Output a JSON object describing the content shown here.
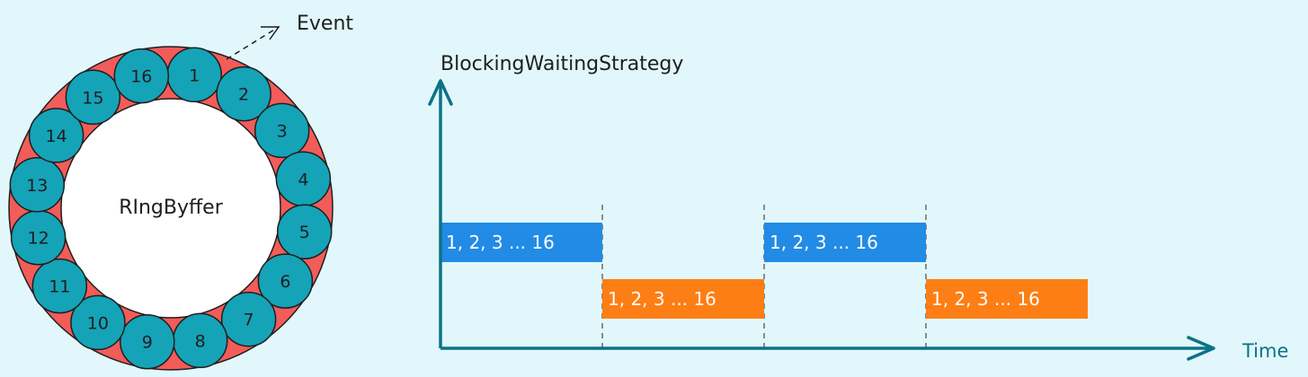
{
  "ring": {
    "label": "RIngByffer",
    "event_label": "Event",
    "slots": [
      "1",
      "2",
      "3",
      "4",
      "5",
      "6",
      "7",
      "8",
      "9",
      "10",
      "11",
      "12",
      "13",
      "14",
      "15",
      "16"
    ],
    "colors": {
      "ring": "#f25c59",
      "slot": "#15a3b8",
      "center": "#ffffff",
      "stroke": "#1e1e1e"
    }
  },
  "timeline": {
    "title": "BlockingWaitingStrategy",
    "x_axis_label": "Time",
    "segments": [
      {
        "label": "1, 2, 3 ... 16",
        "lane": "upper",
        "color": "#228be6"
      },
      {
        "label": "1, 2, 3 ... 16",
        "lane": "lower",
        "color": "#fd7e14"
      },
      {
        "label": "1, 2, 3 ... 16",
        "lane": "upper",
        "color": "#228be6"
      },
      {
        "label": "1, 2, 3 ... 16",
        "lane": "lower",
        "color": "#fd7e14"
      }
    ],
    "colors": {
      "axis": "#0c7286",
      "divider": "#555555"
    }
  }
}
